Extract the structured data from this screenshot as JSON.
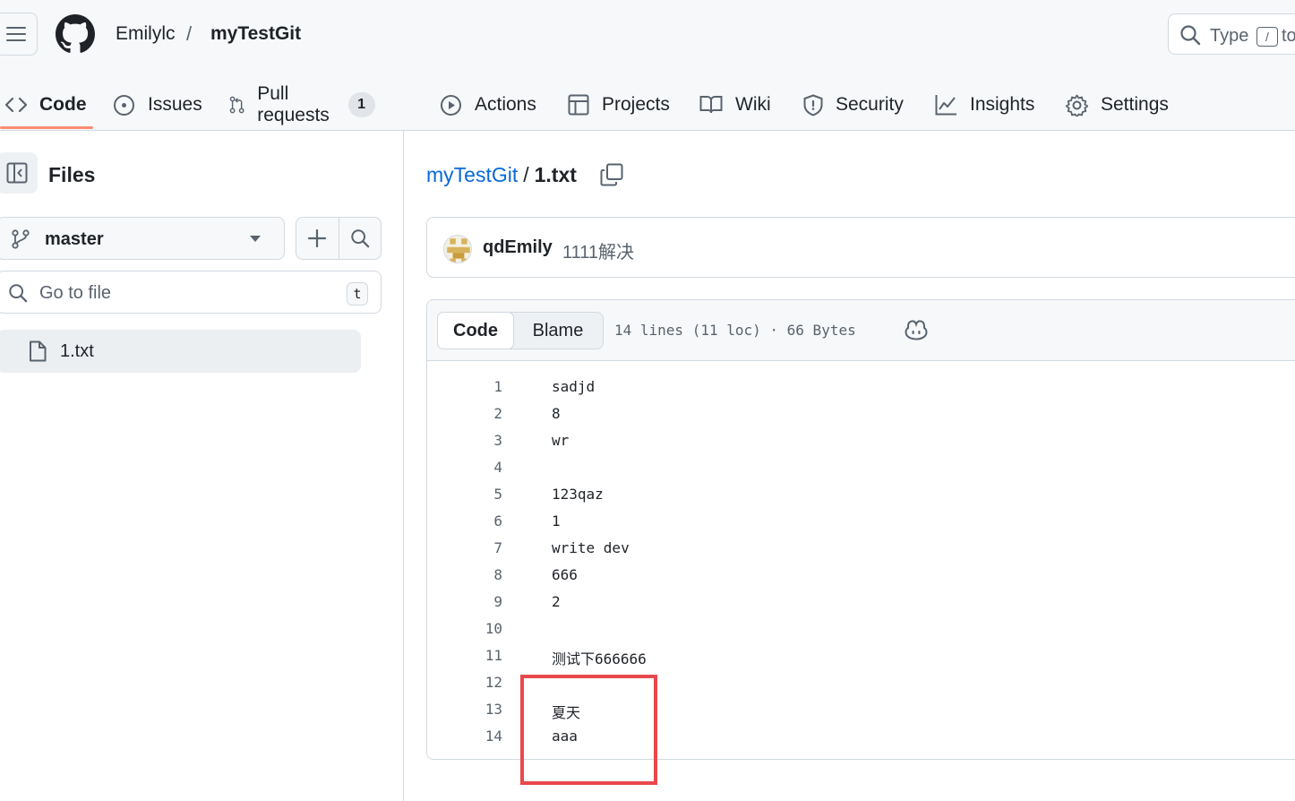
{
  "header": {
    "owner": "Emilylc",
    "separator": "/",
    "repo": "myTestGit",
    "search": {
      "text": "Type",
      "kbd": "/",
      "text_after": "to"
    }
  },
  "tabs": [
    {
      "label": "Code",
      "icon": "code-icon",
      "active": true
    },
    {
      "label": "Issues",
      "icon": "issue-opened-icon"
    },
    {
      "label": "Pull requests",
      "icon": "git-pull-request-icon",
      "count": "1"
    },
    {
      "label": "Actions",
      "icon": "play-icon"
    },
    {
      "label": "Projects",
      "icon": "table-icon"
    },
    {
      "label": "Wiki",
      "icon": "book-icon"
    },
    {
      "label": "Security",
      "icon": "shield-icon"
    },
    {
      "label": "Insights",
      "icon": "graph-icon"
    },
    {
      "label": "Settings",
      "icon": "gear-icon"
    }
  ],
  "sidebar": {
    "title": "Files",
    "branch": "master",
    "goto_placeholder": "Go to file",
    "goto_kbd": "t",
    "files": [
      {
        "name": "1.txt",
        "icon": "file-icon",
        "selected": true
      }
    ]
  },
  "main": {
    "path_repo": "myTestGit",
    "path_sep": "/",
    "path_file": "1.txt",
    "commit": {
      "author": "qdEmily",
      "message": "1111解决"
    },
    "view_tabs": {
      "code": "Code",
      "blame": "Blame"
    },
    "file_meta": "14 lines (11 loc) · 66 Bytes",
    "lines": [
      {
        "n": "1",
        "text": "sadjd"
      },
      {
        "n": "2",
        "text": "8"
      },
      {
        "n": "3",
        "text": "wr"
      },
      {
        "n": "4",
        "text": ""
      },
      {
        "n": "5",
        "text": "123qaz"
      },
      {
        "n": "6",
        "text": "1"
      },
      {
        "n": "7",
        "text": "write dev"
      },
      {
        "n": "8",
        "text": "666"
      },
      {
        "n": "9",
        "text": "2"
      },
      {
        "n": "10",
        "text": ""
      },
      {
        "n": "11",
        "text": "测试下666666"
      },
      {
        "n": "12",
        "text": ""
      },
      {
        "n": "13",
        "text": "夏天"
      },
      {
        "n": "14",
        "text": "aaa"
      }
    ]
  },
  "colors": {
    "accent_link": "#0969da",
    "tab_underline": "#fd8c73",
    "annotation_box": "#e8484c"
  }
}
